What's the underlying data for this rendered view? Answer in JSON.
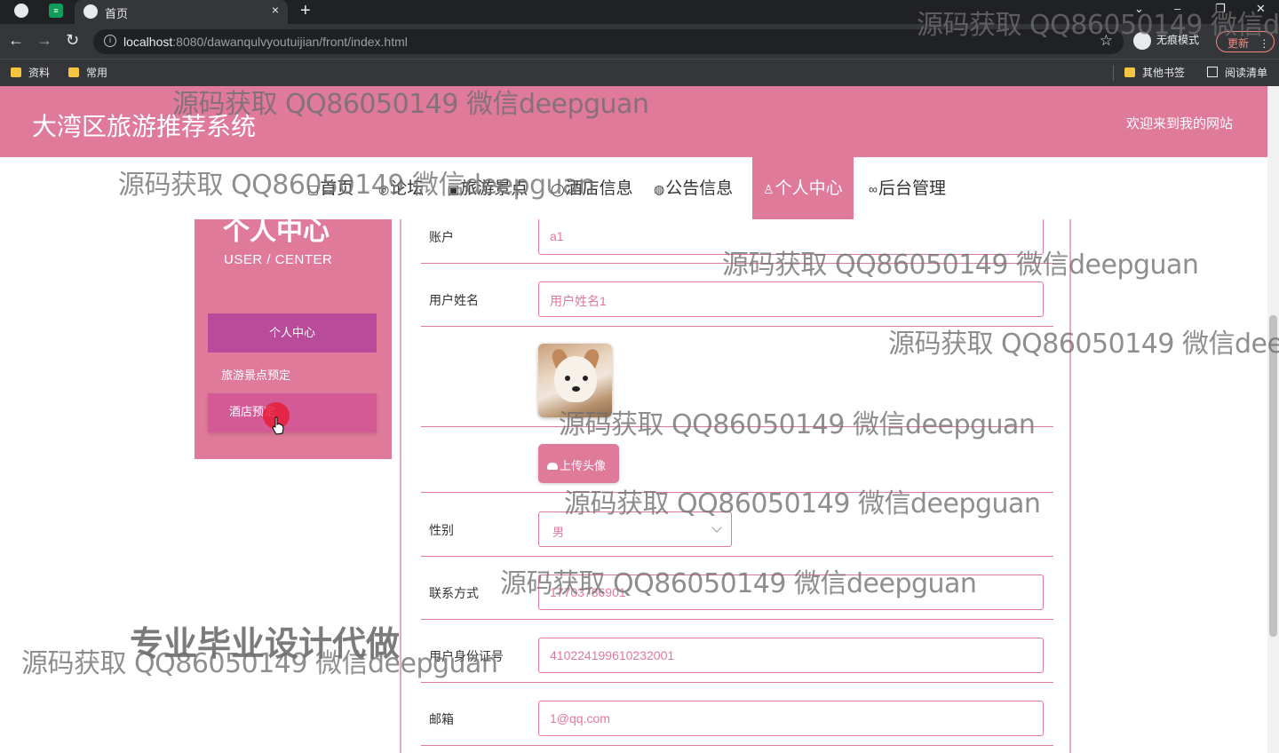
{
  "browser": {
    "tab_title": "首页",
    "close_symbol": "×",
    "newtab_symbol": "+",
    "url_host": "localhost",
    "url_rest": ":8080/dawanqulvyoutuijian/front/index.html",
    "incognito_label": "无痕模式",
    "update_label": "更新",
    "bookmarks": [
      "资料",
      "常用"
    ],
    "other_bookmarks": "其他书签",
    "reading_list": "阅读清单",
    "window_controls": [
      "⌄",
      "–",
      "❐",
      "✕"
    ]
  },
  "site": {
    "title": "大湾区旅游推荐系统",
    "welcome": "欢迎来到我的网站"
  },
  "nav": {
    "items": [
      {
        "icon": "▢",
        "label": "首页"
      },
      {
        "icon": "◎",
        "label": "论坛"
      },
      {
        "icon": "▣",
        "label": "旅游景点"
      },
      {
        "icon": "◯",
        "label": "酒店信息"
      },
      {
        "icon": "◍",
        "label": "公告信息"
      },
      {
        "icon": "♙",
        "label": "个人中心"
      },
      {
        "icon": "∞",
        "label": "后台管理"
      }
    ]
  },
  "sidebar": {
    "title": "个人中心",
    "subtitle": "USER / CENTER",
    "items": [
      "个人中心",
      "旅游景点预定",
      "酒店预定"
    ]
  },
  "form": {
    "account_label": "账户",
    "account_value": "a1",
    "name_label": "用户姓名",
    "name_value": "用户姓名1",
    "upload_label": "上传头像",
    "gender_label": "性别",
    "gender_value": "男",
    "phone_label": "联系方式",
    "phone_value": "17703786901",
    "idcard_label": "用户身份证号",
    "idcard_value": "410224199610232001",
    "email_label": "邮箱",
    "email_value": "1@qq.com"
  },
  "watermarks": {
    "text": "源码获取 QQ86050149 微信deepguan",
    "bold": "专业毕业设计代做"
  },
  "colors": {
    "accent": "#e07a9a",
    "sidebar_active": "#b94c9a"
  }
}
